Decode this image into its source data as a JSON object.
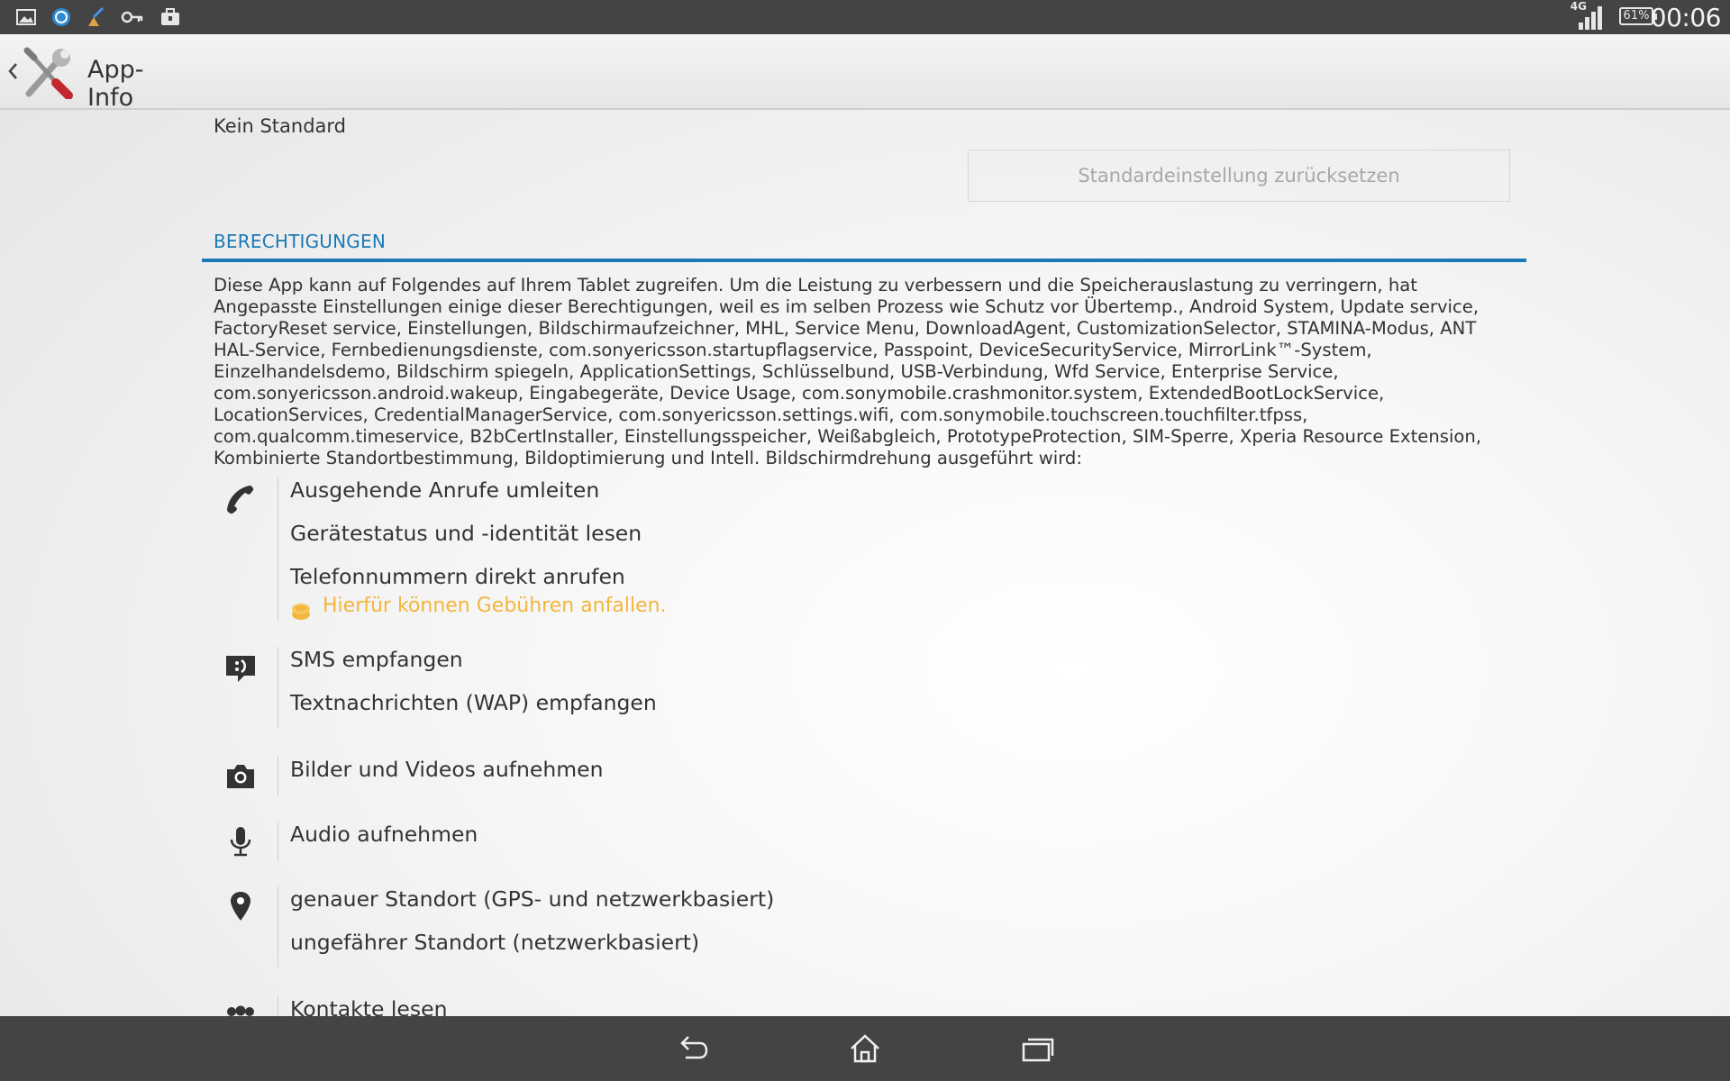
{
  "status_bar": {
    "left_icons": [
      "gallery-icon",
      "shield-app-icon",
      "cleaner-icon",
      "key-icon",
      "briefcase-icon"
    ],
    "network": "4G",
    "battery": "61%",
    "time": "00:06"
  },
  "action_bar": {
    "title": "App-Info",
    "app_icon": "tools-icon"
  },
  "defaults": {
    "label": "Kein Standard",
    "reset_button": "Standardeinstellung zurücksetzen"
  },
  "permissions": {
    "header": "BERECHTIGUNGEN",
    "description": "Diese App kann auf Folgendes auf Ihrem Tablet zugreifen. Um die Leistung zu verbessern und die Speicherauslastung zu verringern, hat Angepasste Einstellungen einige dieser Berechtigungen, weil es im selben Prozess wie Schutz vor Übertemp., Android System, Update service, FactoryReset service, Einstellungen, Bildschirmaufzeichner, MHL, Service Menu, DownloadAgent, CustomizationSelector, STAMINA-Modus, ANT HAL-Service, Fernbedienungsdienste, com.sonyericsson.startupflagservice, Passpoint, DeviceSecurityService, MirrorLink™-System, Einzelhandelsdemo, Bildschirm spiegeln, ApplicationSettings, Schlüsselbund, USB-Verbindung, Wfd Service, Enterprise Service, com.sonyericsson.android.wakeup, Eingabegeräte, Device Usage, com.sonymobile.crashmonitor.system, ExtendedBootLockService, LocationServices, CredentialManagerService, com.sonyericsson.settings.wifi, com.sonymobile.touchscreen.touchfilter.tfpss, com.qualcomm.timeservice, B2bCertInstaller, Einstellungsspeicher, Weißabgleich, PrototypeProtection, SIM-Sperre, Xperia Resource Extension, Kombinierte Standortbestimmung, Bildoptimierung und Intell. Bildschirmdrehung ausgeführt wird:",
    "groups": [
      {
        "icon": "phone-icon",
        "items": [
          "Ausgehende Anrufe umleiten",
          "Gerätestatus und -identität lesen",
          "Telefonnummern direkt anrufen"
        ],
        "warning": "Hierfür können Gebühren anfallen."
      },
      {
        "icon": "message-icon",
        "items": [
          "SMS empfangen",
          "Textnachrichten (WAP) empfangen"
        ]
      },
      {
        "icon": "camera-icon",
        "items": [
          "Bilder und Videos aufnehmen"
        ]
      },
      {
        "icon": "microphone-icon",
        "items": [
          "Audio aufnehmen"
        ]
      },
      {
        "icon": "location-pin-icon",
        "items": [
          "genauer Standort (GPS- und netzwerkbasiert)",
          "ungefährer Standort (netzwerkbasiert)"
        ]
      },
      {
        "icon": "contacts-icon",
        "items": [
          "Kontakte lesen"
        ]
      }
    ]
  },
  "nav_bar": {
    "buttons": [
      "back-icon",
      "home-icon",
      "recent-apps-icon"
    ]
  }
}
